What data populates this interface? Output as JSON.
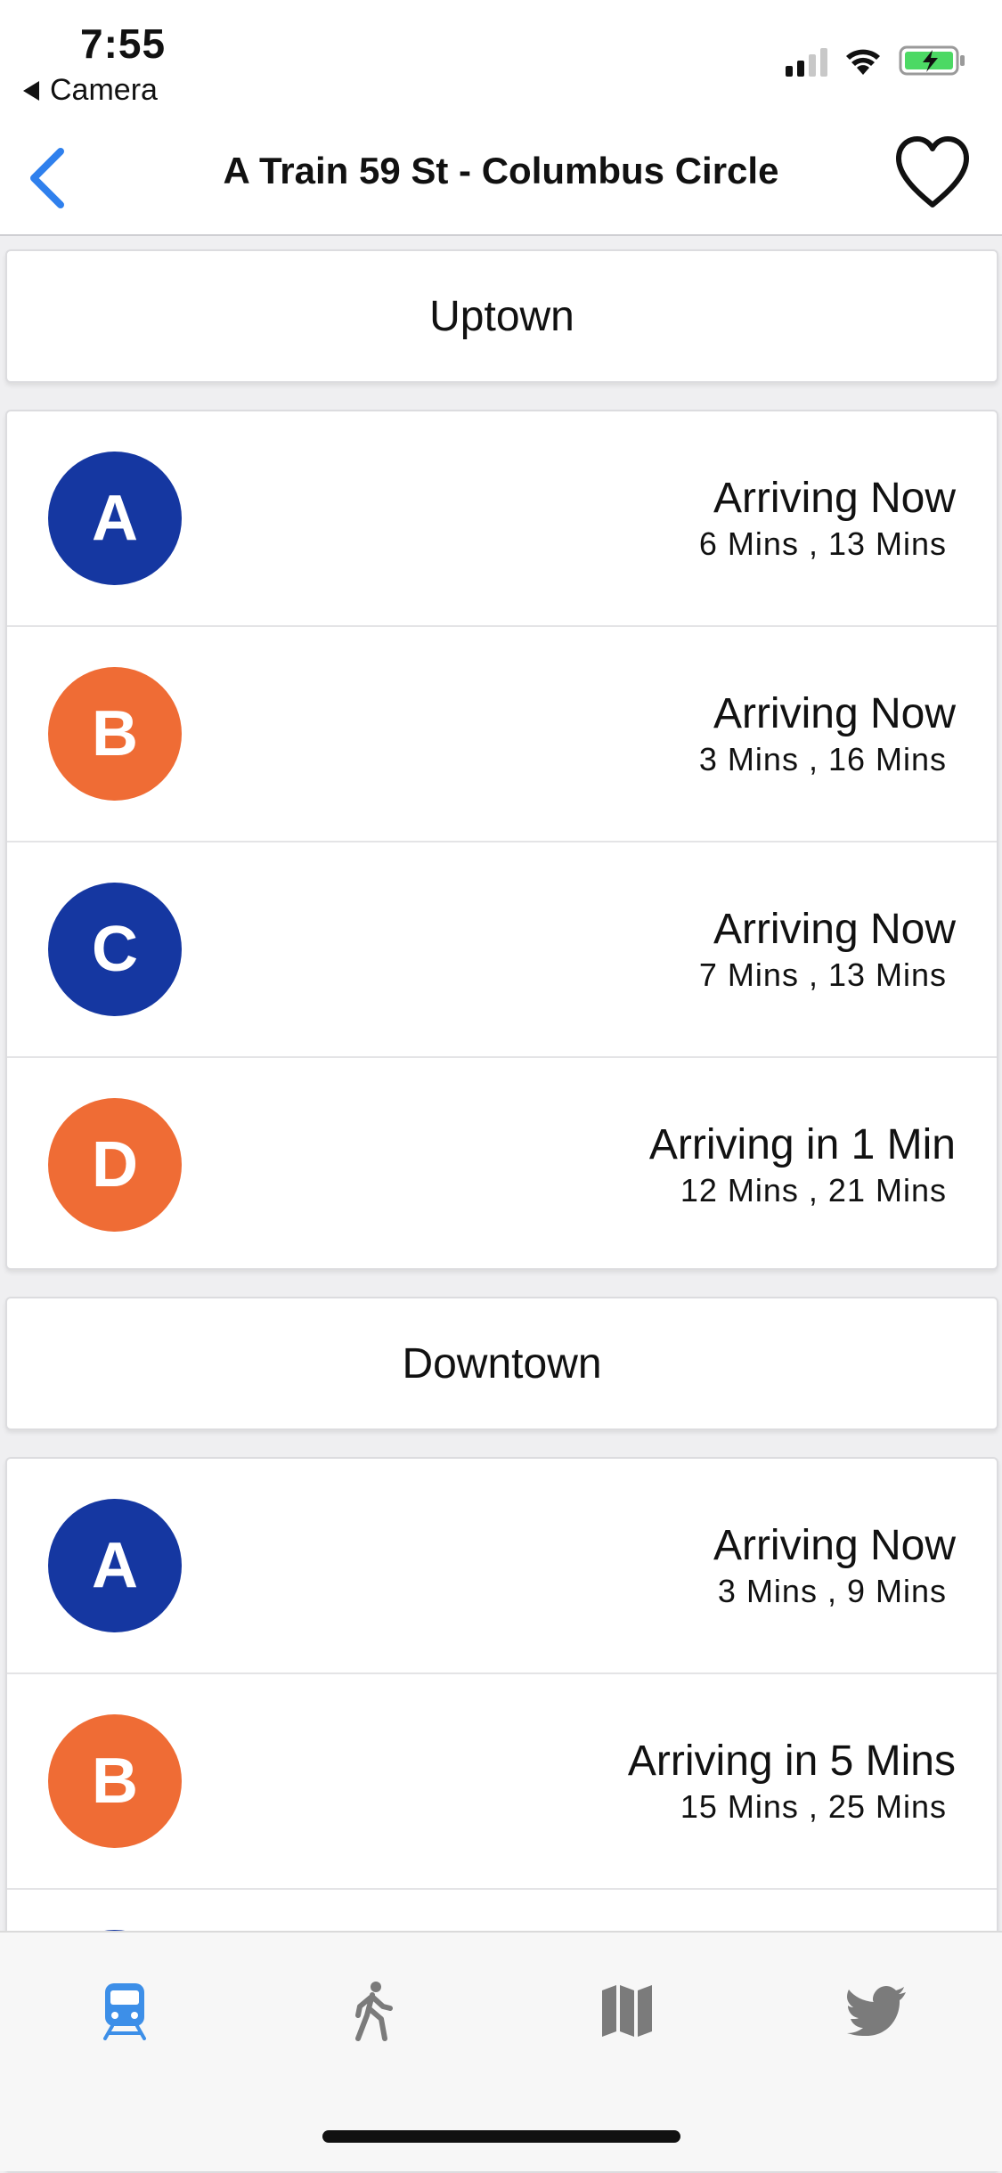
{
  "status_bar": {
    "time": "7:55",
    "back_app": "Camera",
    "icons": [
      "signal-icon",
      "wifi-icon",
      "battery-charging-icon"
    ]
  },
  "nav": {
    "title": "A Train 59 St - Columbus Circle",
    "back_icon": "chevron-left-icon",
    "favorite_icon": "heart-outline-icon"
  },
  "colors": {
    "accent": "#2f80ed",
    "line_blue": "#1537a1",
    "line_orange": "#ef6c35",
    "tab_active": "#3d8fe8",
    "tab_inactive": "#7b7b7b"
  },
  "sections": [
    {
      "direction": "Uptown",
      "trains": [
        {
          "line": "A",
          "color": "#1537a1",
          "arrival": "Arriving Now",
          "next": "6 Mins , 13 Mins"
        },
        {
          "line": "B",
          "color": "#ef6c35",
          "arrival": "Arriving Now",
          "next": "3 Mins , 16 Mins"
        },
        {
          "line": "C",
          "color": "#1537a1",
          "arrival": "Arriving Now",
          "next": "7 Mins , 13 Mins"
        },
        {
          "line": "D",
          "color": "#ef6c35",
          "arrival": "Arriving in 1 Min",
          "next": "12 Mins , 21 Mins"
        }
      ]
    },
    {
      "direction": "Downtown",
      "trains": [
        {
          "line": "A",
          "color": "#1537a1",
          "arrival": "Arriving Now",
          "next": "3 Mins , 9 Mins"
        },
        {
          "line": "B",
          "color": "#ef6c35",
          "arrival": "Arriving in 5 Mins",
          "next": "15 Mins , 25 Mins"
        },
        {
          "line": "",
          "color": "#1537a1",
          "arrival": "",
          "next": ""
        }
      ]
    }
  ],
  "tabbar": {
    "tabs": [
      {
        "icon": "train-icon",
        "active": true
      },
      {
        "icon": "walking-icon",
        "active": false
      },
      {
        "icon": "map-icon",
        "active": false
      },
      {
        "icon": "twitter-bird-icon",
        "active": false
      }
    ]
  }
}
